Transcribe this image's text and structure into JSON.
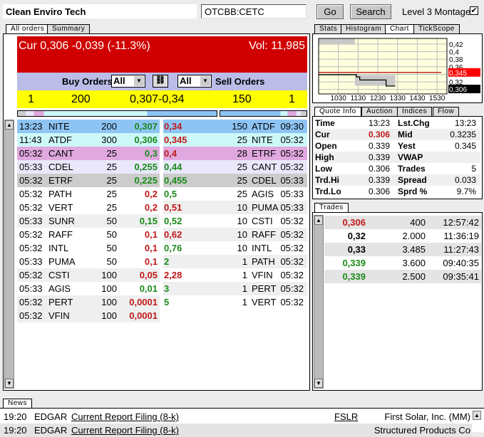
{
  "title": "Clean Enviro Tech",
  "symbol": "OTCBB:CETC",
  "buttons": {
    "go": "Go",
    "search": "Search"
  },
  "level3": {
    "label": "Level 3 Montage",
    "checked": true
  },
  "left_tabs": [
    "All orders",
    "Summary"
  ],
  "header": {
    "cur": "Cur 0,306 -0,039 (-11.3%)",
    "vol": "Vol: 11,985"
  },
  "filters": {
    "buy_label": "Buy Orders",
    "buy_value": "All",
    "sell_value": "All",
    "sell_label": "Sell Orders"
  },
  "inside": {
    "bid_count": "1",
    "bid_size": "200",
    "bid_ask": "0,307-0,34",
    "ask_size": "150",
    "ask_count": "1"
  },
  "buy_orders": [
    {
      "time": "13:23",
      "mm": "NITE",
      "size": "200",
      "price": "0,307",
      "c": "g",
      "bg": "#8ec4f4"
    },
    {
      "time": "11:43",
      "mm": "ATDF",
      "size": "300",
      "price": "0,306",
      "c": "g",
      "bg": "#cdf8f8"
    },
    {
      "time": "05:32",
      "mm": "CANT",
      "size": "25",
      "price": "0,3",
      "c": "g",
      "bg": "#e0a8de"
    },
    {
      "time": "05:33",
      "mm": "CDEL",
      "size": "25",
      "price": "0,255",
      "c": "g",
      "bg": "#e8e8fa"
    },
    {
      "time": "05:32",
      "mm": "ETRF",
      "size": "25",
      "price": "0,225",
      "c": "g",
      "bg": "#cccccc"
    },
    {
      "time": "05:32",
      "mm": "PATH",
      "size": "25",
      "price": "0,2",
      "c": "r",
      "bg": "#ffffff"
    },
    {
      "time": "05:32",
      "mm": "VERT",
      "size": "25",
      "price": "0,2",
      "c": "r",
      "bg": "#ffffff"
    },
    {
      "time": "05:33",
      "mm": "SUNR",
      "size": "50",
      "price": "0,15",
      "c": "g",
      "bg": "#efefef"
    },
    {
      "time": "05:32",
      "mm": "RAFF",
      "size": "50",
      "price": "0,1",
      "c": "r",
      "bg": "#ffffff"
    },
    {
      "time": "05:32",
      "mm": "INTL",
      "size": "50",
      "price": "0,1",
      "c": "r",
      "bg": "#ffffff"
    },
    {
      "time": "05:33",
      "mm": "PUMA",
      "size": "50",
      "price": "0,1",
      "c": "r",
      "bg": "#ffffff"
    },
    {
      "time": "05:32",
      "mm": "CSTI",
      "size": "100",
      "price": "0,05",
      "c": "r",
      "bg": "#efefef"
    },
    {
      "time": "05:33",
      "mm": "AGIS",
      "size": "100",
      "price": "0,01",
      "c": "g",
      "bg": "#ffffff"
    },
    {
      "time": "05:32",
      "mm": "PERT",
      "size": "100",
      "price": "0,0001",
      "c": "r",
      "bg": "#efefef"
    },
    {
      "time": "05:32",
      "mm": "VFIN",
      "size": "100",
      "price": "0,0001",
      "c": "r",
      "bg": "#efefef"
    }
  ],
  "sell_orders": [
    {
      "price": "0,34",
      "c": "r",
      "size": "150",
      "mm": "ATDF",
      "time": "09:30",
      "bg": "#8ec4f4"
    },
    {
      "price": "0,345",
      "c": "r",
      "size": "25",
      "mm": "NITE",
      "time": "05:32",
      "bg": "#cdf8f8"
    },
    {
      "price": "0,4",
      "c": "r",
      "size": "28",
      "mm": "ETRF",
      "time": "05:32",
      "bg": "#e0a8de"
    },
    {
      "price": "0,44",
      "c": "g",
      "size": "25",
      "mm": "CANT",
      "time": "05:32",
      "bg": "#e8e8fa"
    },
    {
      "price": "0,455",
      "c": "g",
      "size": "25",
      "mm": "CDEL",
      "time": "05:33",
      "bg": "#cccccc"
    },
    {
      "price": "0,5",
      "c": "g",
      "size": "25",
      "mm": "AGIS",
      "time": "05:33",
      "bg": "#ffffff"
    },
    {
      "price": "0,51",
      "c": "r",
      "size": "10",
      "mm": "PUMA",
      "time": "05:33",
      "bg": "#efefef"
    },
    {
      "price": "0,52",
      "c": "g",
      "size": "10",
      "mm": "CSTI",
      "time": "05:32",
      "bg": "#ffffff"
    },
    {
      "price": "0,62",
      "c": "r",
      "size": "10",
      "mm": "RAFF",
      "time": "05:32",
      "bg": "#efefef"
    },
    {
      "price": "0,76",
      "c": "g",
      "size": "10",
      "mm": "INTL",
      "time": "05:32",
      "bg": "#ffffff"
    },
    {
      "price": "2",
      "c": "g",
      "size": "1",
      "mm": "PATH",
      "time": "05:32",
      "bg": "#efefef"
    },
    {
      "price": "2,28",
      "c": "r",
      "size": "1",
      "mm": "VFIN",
      "time": "05:32",
      "bg": "#ffffff"
    },
    {
      "price": "3",
      "c": "g",
      "size": "1",
      "mm": "PERT",
      "time": "05:32",
      "bg": "#efefef"
    },
    {
      "price": "5",
      "c": "g",
      "size": "1",
      "mm": "VERT",
      "time": "05:32",
      "bg": "#ffffff"
    }
  ],
  "right_tabs": [
    "Stats",
    "Histogram",
    "Chart",
    "TickScope"
  ],
  "chart_data": {
    "type": "line",
    "x_ticks": [
      "1030",
      "1130",
      "1230",
      "1330",
      "1430",
      "1530"
    ],
    "y_ticks": [
      "0,42",
      "0,4",
      "0,38",
      "0,36",
      "0,32"
    ],
    "xlim": [
      "09:30",
      "16:00"
    ],
    "ylim": [
      0.288,
      0.435
    ],
    "price_line": [
      [
        "09:30",
        0.339
      ],
      [
        "11:25",
        0.339
      ],
      [
        "11:25",
        0.333
      ],
      [
        "11:35",
        0.333
      ],
      [
        "11:35",
        0.325
      ],
      [
        "12:55",
        0.325
      ],
      [
        "12:55",
        0.309
      ],
      [
        "13:23",
        0.309
      ]
    ],
    "reference_line": {
      "value": 0.345,
      "label": "0,345",
      "color": "#ff0000"
    },
    "last_label": "0,306",
    "range_bands": [
      [
        "09:30",
        "11:20",
        0.42,
        0.435
      ],
      [
        "11:20",
        "13:23",
        0.31,
        0.338
      ]
    ]
  },
  "quote_tabs": [
    "Quote Info",
    "Auction",
    "Indices",
    "Flow"
  ],
  "quote": [
    [
      "Time",
      "13:23",
      "Lst.Chg",
      "13:23"
    ],
    [
      "Cur",
      "0.306",
      "Mid",
      "0.3235"
    ],
    [
      "Open",
      "0.339",
      "Yest",
      "0.345"
    ],
    [
      "High",
      "0.339",
      "VWAP",
      ""
    ],
    [
      "Low",
      "0.306",
      "Trades",
      "5"
    ],
    [
      "Trd.Hi",
      "0.339",
      "Spread",
      "0.033"
    ],
    [
      "Trd.Lo",
      "0.306",
      "Sprd %",
      "9.7%"
    ]
  ],
  "trades_tab": "Trades",
  "trades": [
    {
      "price": "0,306",
      "c": "r",
      "size": "400",
      "time": "12:57:42"
    },
    {
      "price": "0,32",
      "c": "k",
      "size": "2.000",
      "time": "11:36:19"
    },
    {
      "price": "0,33",
      "c": "k",
      "size": "3.485",
      "time": "11:27:43"
    },
    {
      "price": "0,339",
      "c": "g",
      "size": "3.600",
      "time": "09:40:35"
    },
    {
      "price": "0,339",
      "c": "g",
      "size": "2.500",
      "time": "09:35:41"
    }
  ],
  "news_tab": "News",
  "news": [
    {
      "time": "19:20",
      "source": "EDGAR",
      "headline": "Current Report Filing (8-k)",
      "symbol": "FSLR",
      "company": "First Solar, Inc. (MM)"
    },
    {
      "time": "19:20",
      "source": "EDGAR",
      "headline": "Current Report Filing (8-k)",
      "symbol": "",
      "company": "Structured Products Co"
    }
  ]
}
